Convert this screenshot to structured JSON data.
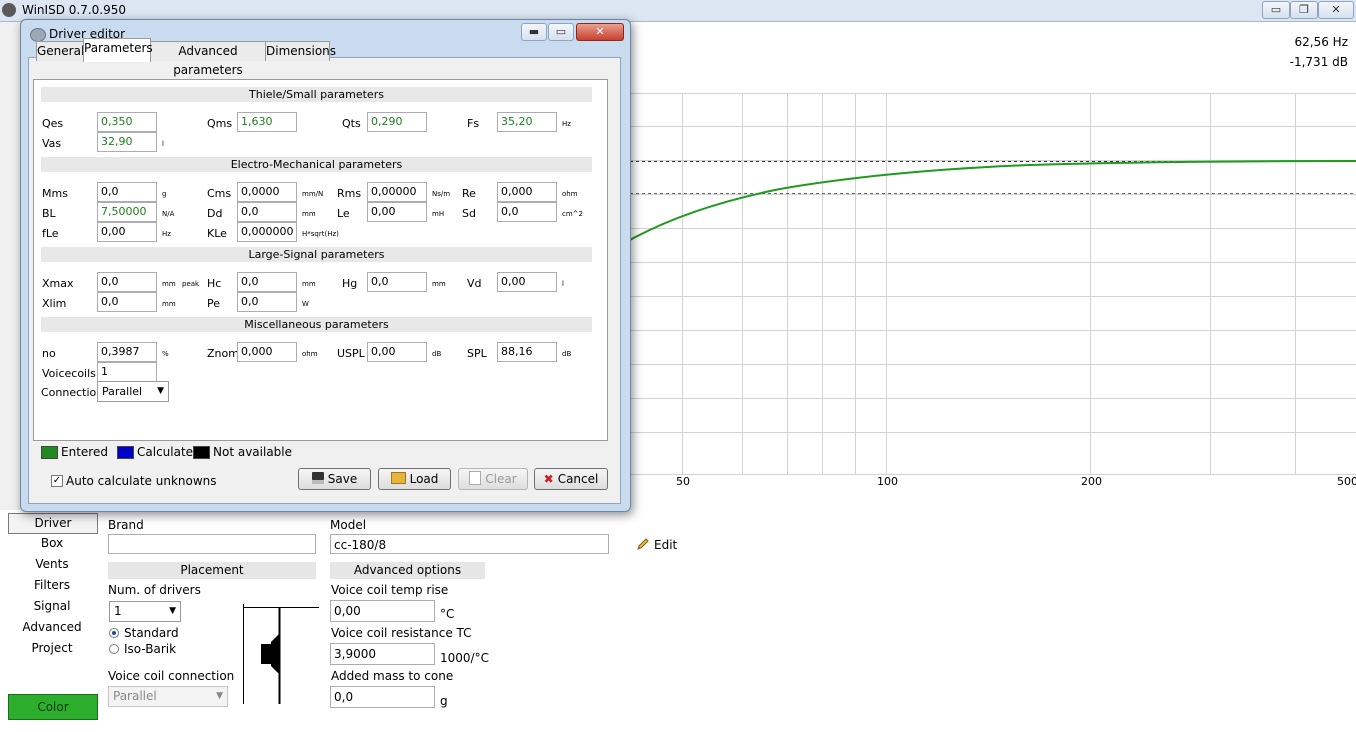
{
  "app": {
    "title": "WinISD 0.7.0.950",
    "min_label": "▭",
    "max_label": "❐",
    "close_label": "✕"
  },
  "readout": {
    "freq": "62,56 Hz",
    "db": "-1,731 dB"
  },
  "graph": {
    "x_ticks": [
      "50",
      "100",
      "200",
      "500"
    ]
  },
  "nav": {
    "items": [
      "Driver",
      "Box",
      "Vents",
      "Filters",
      "Signal",
      "Advanced",
      "Project"
    ],
    "color_label": "Color"
  },
  "driver_panel": {
    "brand_label": "Brand",
    "brand_value": "",
    "model_label": "Model",
    "model_value": "cc-180/8",
    "edit_label": "Edit",
    "placement_header": "Placement",
    "num_drivers_label": "Num. of drivers",
    "num_drivers_value": "1",
    "standard_label": "Standard",
    "isobarik_label": "Iso-Barik",
    "vc_connection_label": "Voice coil connection",
    "vc_connection_value": "Parallel",
    "advanced_header": "Advanced options",
    "vc_temp_label": "Voice coil temp rise",
    "vc_temp_value": "0,00",
    "vc_temp_unit": "°C",
    "vc_res_label": "Voice coil resistance TC",
    "vc_res_value": "3,9000",
    "vc_res_unit": "1000/°C",
    "added_mass_label": "Added mass to cone",
    "added_mass_value": "0,0",
    "added_mass_unit": "g"
  },
  "dialog": {
    "title": "Driver editor",
    "tabs": [
      "General",
      "Parameters",
      "Advanced parameters",
      "Dimensions"
    ],
    "sections": {
      "ts": "Thiele/Small parameters",
      "em": "Electro-Mechanical parameters",
      "ls": "Large-Signal parameters",
      "misc": "Miscellaneous parameters"
    },
    "params": {
      "qes": {
        "label": "Qes",
        "value": "0,350",
        "unit": ""
      },
      "qms": {
        "label": "Qms",
        "value": "1,630",
        "unit": ""
      },
      "qts": {
        "label": "Qts",
        "value": "0,290",
        "unit": ""
      },
      "fs": {
        "label": "Fs",
        "value": "35,20",
        "unit": "Hz"
      },
      "vas": {
        "label": "Vas",
        "value": "32,90",
        "unit": "l"
      },
      "mms": {
        "label": "Mms",
        "value": "0,0",
        "unit": "g"
      },
      "cms": {
        "label": "Cms",
        "value": "0,0000",
        "unit": "mm/N"
      },
      "rms": {
        "label": "Rms",
        "value": "0,00000",
        "unit": "Ns/m"
      },
      "re": {
        "label": "Re",
        "value": "0,000",
        "unit": "ohm"
      },
      "bl": {
        "label": "BL",
        "value": "7,50000",
        "unit": "N/A"
      },
      "dd": {
        "label": "Dd",
        "value": "0,0",
        "unit": "mm"
      },
      "le": {
        "label": "Le",
        "value": "0,00",
        "unit": "mH"
      },
      "sd": {
        "label": "Sd",
        "value": "0,0",
        "unit": "cm^2"
      },
      "fle": {
        "label": "fLe",
        "value": "0,00",
        "unit": "Hz"
      },
      "kle": {
        "label": "KLe",
        "value": "0,000000",
        "unit": "H*sqrt(Hz)"
      },
      "xmax": {
        "label": "Xmax",
        "value": "0,0",
        "unit": "mm",
        "unit2": "peak"
      },
      "hc": {
        "label": "Hc",
        "value": "0,0",
        "unit": "mm"
      },
      "hg": {
        "label": "Hg",
        "value": "0,0",
        "unit": "mm"
      },
      "vd": {
        "label": "Vd",
        "value": "0,00",
        "unit": "l"
      },
      "xlim": {
        "label": "Xlim",
        "value": "0,0",
        "unit": "mm"
      },
      "pe": {
        "label": "Pe",
        "value": "0,0",
        "unit": "W"
      },
      "no": {
        "label": "no",
        "value": "0,3987",
        "unit": "%"
      },
      "znom": {
        "label": "Znom",
        "value": "0,000",
        "unit": "ohm"
      },
      "uspl": {
        "label": "USPL",
        "value": "0,00",
        "unit": "dB"
      },
      "spl": {
        "label": "SPL",
        "value": "88,16",
        "unit": "dB"
      },
      "voicecoils": {
        "label": "Voicecoils",
        "value": "1"
      },
      "connection": {
        "label": "Connection",
        "value": "Parallel"
      }
    },
    "legend": {
      "entered": "Entered",
      "calculated": "Calculated",
      "na": "Not available",
      "entered_color": "#1f8a1f",
      "calculated_color": "#0000c8",
      "na_color": "#000000"
    },
    "auto_calc_label": "Auto calculate unknowns",
    "buttons": {
      "save": "Save",
      "load": "Load",
      "clear": "Clear",
      "cancel": "Cancel"
    }
  }
}
